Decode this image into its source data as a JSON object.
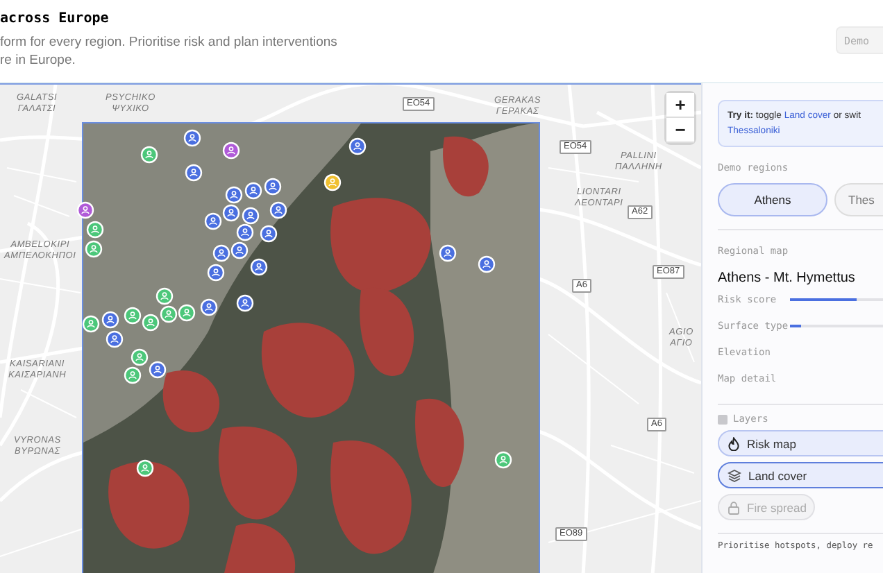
{
  "header": {
    "title": "across Europe",
    "subtitle_lines": [
      "form for every region. Prioritise risk and plan interventions",
      "re in Europe."
    ],
    "demo_button": "Demo"
  },
  "map": {
    "zoom_in": "+",
    "zoom_out": "−",
    "places": [
      {
        "latin": "GALATSI",
        "greek": "ΓΑΛΑΤΣΙ"
      },
      {
        "latin": "PSYCHIKO",
        "greek": "ΨΥΧΙΚΟ"
      },
      {
        "latin": "AMBELOKIPI",
        "greek": "ΑΜΠΕΛΟΚΗΠΟΙ"
      },
      {
        "latin": "GERAKAS",
        "greek": "ΓΕΡΑΚΑΣ"
      },
      {
        "latin": "PALLINI",
        "greek": "ΠΑΛΛΗΝΗ"
      },
      {
        "latin": "LIONTARI",
        "greek": "ΛΕΟΝΤΑΡΙ"
      },
      {
        "latin": "KAISARIANI",
        "greek": "ΚΑΙΣΑΡΙΑΝΗ"
      },
      {
        "latin": "VYRONAS",
        "greek": "ΒΥΡΩΝΑΣ"
      },
      {
        "latin": "AGIO",
        "greek": "ΑΓΙΟ"
      }
    ],
    "road_shields": [
      "EO54",
      "EO54",
      "A62",
      "EO87",
      "A6",
      "A6",
      "EO89"
    ],
    "markers": [
      {
        "color": "#4a6fe0"
      },
      {
        "color": "#b05ad8"
      },
      {
        "color": "#4cc77a"
      },
      {
        "color": "#4a6fe0"
      },
      {
        "color": "#f0c030"
      },
      {
        "color": "#4a6fe0"
      },
      {
        "color": "#4a6fe0"
      },
      {
        "color": "#4a6fe0"
      },
      {
        "color": "#4a6fe0"
      },
      {
        "color": "#4a6fe0"
      },
      {
        "color": "#4a6fe0"
      },
      {
        "color": "#4a6fe0"
      },
      {
        "color": "#4a6fe0"
      },
      {
        "color": "#4a6fe0"
      },
      {
        "color": "#4a6fe0"
      },
      {
        "color": "#4a6fe0"
      },
      {
        "color": "#4a6fe0"
      },
      {
        "color": "#4a6fe0"
      },
      {
        "color": "#4a6fe0"
      },
      {
        "color": "#4a6fe0"
      },
      {
        "color": "#4a6fe0"
      },
      {
        "color": "#b05ad8"
      },
      {
        "color": "#4cc77a"
      },
      {
        "color": "#4cc77a"
      },
      {
        "color": "#4cc77a"
      },
      {
        "color": "#4cc77a"
      },
      {
        "color": "#4cc77a"
      },
      {
        "color": "#4cc77a"
      },
      {
        "color": "#4cc77a"
      },
      {
        "color": "#4cc77a"
      },
      {
        "color": "#4a6fe0"
      },
      {
        "color": "#4a6fe0"
      },
      {
        "color": "#4cc77a"
      },
      {
        "color": "#4a6fe0"
      },
      {
        "color": "#4a6fe0"
      },
      {
        "color": "#4cc77a"
      },
      {
        "color": "#4a6fe0"
      },
      {
        "color": "#4cc77a"
      },
      {
        "color": "#4cc77a"
      }
    ]
  },
  "sidebar": {
    "tip": {
      "lead": "Try it:",
      "text_1": "toggle",
      "link_1": "Land cover",
      "text_2": "or swit",
      "link_2": "Thessaloniki"
    },
    "regions_label": "Demo regions",
    "regions": [
      {
        "label": "Athens",
        "selected": true
      },
      {
        "label": "Thes",
        "selected": false
      }
    ],
    "map_label": "Regional map",
    "map_title": "Athens - Mt. Hymettus",
    "controls": [
      {
        "kind": "slider",
        "label": "Risk score",
        "level": 0.6
      },
      {
        "kind": "slider",
        "label": "Surface type",
        "level": 0.1
      },
      {
        "kind": "plain",
        "label": "Elevation"
      },
      {
        "kind": "plain",
        "label": "Map detail"
      }
    ],
    "layers_label": "Layers",
    "layers": [
      {
        "label": "Risk map",
        "on": true,
        "focused": false,
        "locked": false
      },
      {
        "label": "Land cover",
        "on": true,
        "focused": true,
        "locked": false
      },
      {
        "label": "Fire spread",
        "on": false,
        "focused": false,
        "locked": true
      }
    ],
    "footer_text": "Prioritise hotspots, deploy re"
  }
}
